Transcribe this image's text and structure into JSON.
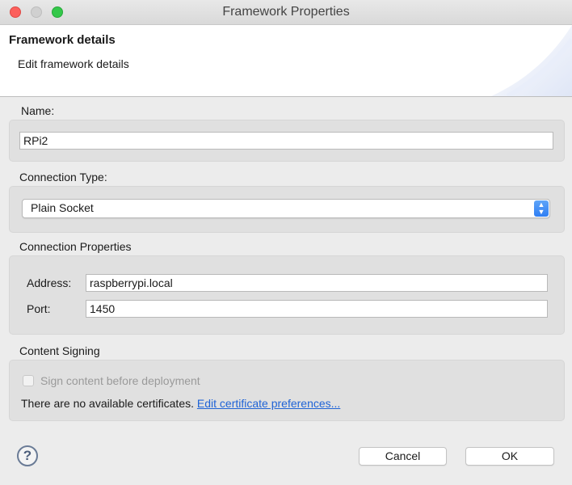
{
  "window": {
    "title": "Framework Properties",
    "controls": [
      "close-icon",
      "minimize-icon",
      "zoom-icon"
    ]
  },
  "header": {
    "title": "Framework details",
    "subtitle": "Edit framework details"
  },
  "name_section": {
    "label": "Name:",
    "value": "RPi2"
  },
  "connection_type": {
    "label": "Connection Type:",
    "selected": "Plain Socket",
    "accent_color": "#2f7ef3"
  },
  "connection_properties": {
    "label": "Connection Properties",
    "address_label": "Address:",
    "address_value": "raspberrypi.local",
    "port_label": "Port:",
    "port_value": "1450"
  },
  "content_signing": {
    "label": "Content Signing",
    "checkbox_label": "Sign content before deployment",
    "checkbox_checked": false,
    "checkbox_enabled": false,
    "message": "There are no available certificates.",
    "link_text": "Edit certificate preferences..."
  },
  "footer": {
    "help_icon": "help-icon",
    "help_glyph": "?",
    "cancel_label": "Cancel",
    "ok_label": "OK"
  }
}
